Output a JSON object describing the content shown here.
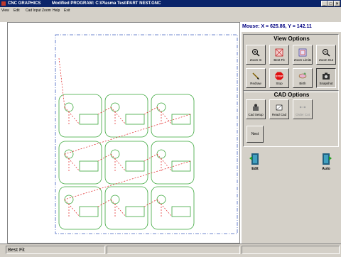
{
  "titlebar": {
    "app_title": "CNC GRAPHICS",
    "doc_title": "Modified  PROGRAM: C:\\Plasma Test\\PART NEST.GNC",
    "min": "_",
    "max": "□",
    "close": "×"
  },
  "menu": {
    "view": "View",
    "edit": "Edit",
    "cad_input": "Cad Input",
    "zoom": "Zoom",
    "help": "Help",
    "exit": "Exit"
  },
  "coords": {
    "text": "Mouse: X = 625.86, Y = 142.11"
  },
  "view_options": {
    "title": "View Options",
    "buttons": [
      {
        "label": "Zoom In",
        "icon": "zoom-in-icon"
      },
      {
        "label": "Best Fit",
        "icon": "best-fit-icon"
      },
      {
        "label": "Zoom Limits",
        "icon": "zoom-limits-icon"
      },
      {
        "label": "Zoom Out",
        "icon": "zoom-out-icon"
      },
      {
        "label": "Redraw",
        "icon": "redraw-icon"
      },
      {
        "label": "Stop",
        "icon": "stop-icon",
        "icon_text": "STOP"
      },
      {
        "label": "Birth",
        "icon": "birth-icon"
      },
      {
        "label": "Snapshot",
        "icon": "snapshot-icon"
      }
    ]
  },
  "cad_options": {
    "title": "CAD Options",
    "buttons": [
      {
        "label": "Cad Setup",
        "icon": "cad-setup-icon"
      },
      {
        "label": "Read Cad",
        "icon": "read-cad-icon"
      },
      {
        "label": "Order Cut",
        "icon": "order-cut-icon"
      }
    ],
    "nest_label": "Nest"
  },
  "bottom_buttons": {
    "edit_label": "Edit",
    "auto_label": "Auto"
  },
  "status": {
    "text": "Best Fit"
  },
  "colors": {
    "part_outline": "#3aa63a",
    "rapid_path": "#e02020",
    "plate_limit": "#4060c0"
  }
}
